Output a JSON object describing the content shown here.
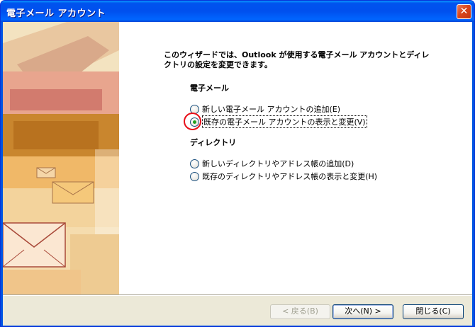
{
  "window": {
    "title": "電子メール アカウント",
    "close_icon": "close-icon",
    "close_glyph": "✕"
  },
  "intro": {
    "line1": "このウィザードでは、Outlook が使用する電子メール アカウントとディレ",
    "line2": "クトリの設定を変更できます。"
  },
  "email_section": {
    "label": "電子メール",
    "options": [
      {
        "label": "新しい電子メール アカウントの追加(E)",
        "checked": false
      },
      {
        "label": "既存の電子メール アカウントの表示と変更(V)",
        "checked": true
      }
    ]
  },
  "directory_section": {
    "label": "ディレクトリ",
    "options": [
      {
        "label": "新しいディレクトリやアドレス帳の追加(D)",
        "checked": false
      },
      {
        "label": "既存のディレクトリやアドレス帳の表示と変更(H)",
        "checked": false
      }
    ]
  },
  "buttons": {
    "back": "< 戻る(B)",
    "next": "次へ(N) >",
    "close": "閉じる(C)"
  },
  "colors": {
    "titlebar": "#0054e3",
    "highlight_circle": "#e8101a",
    "radio_checked": "#21a121"
  }
}
